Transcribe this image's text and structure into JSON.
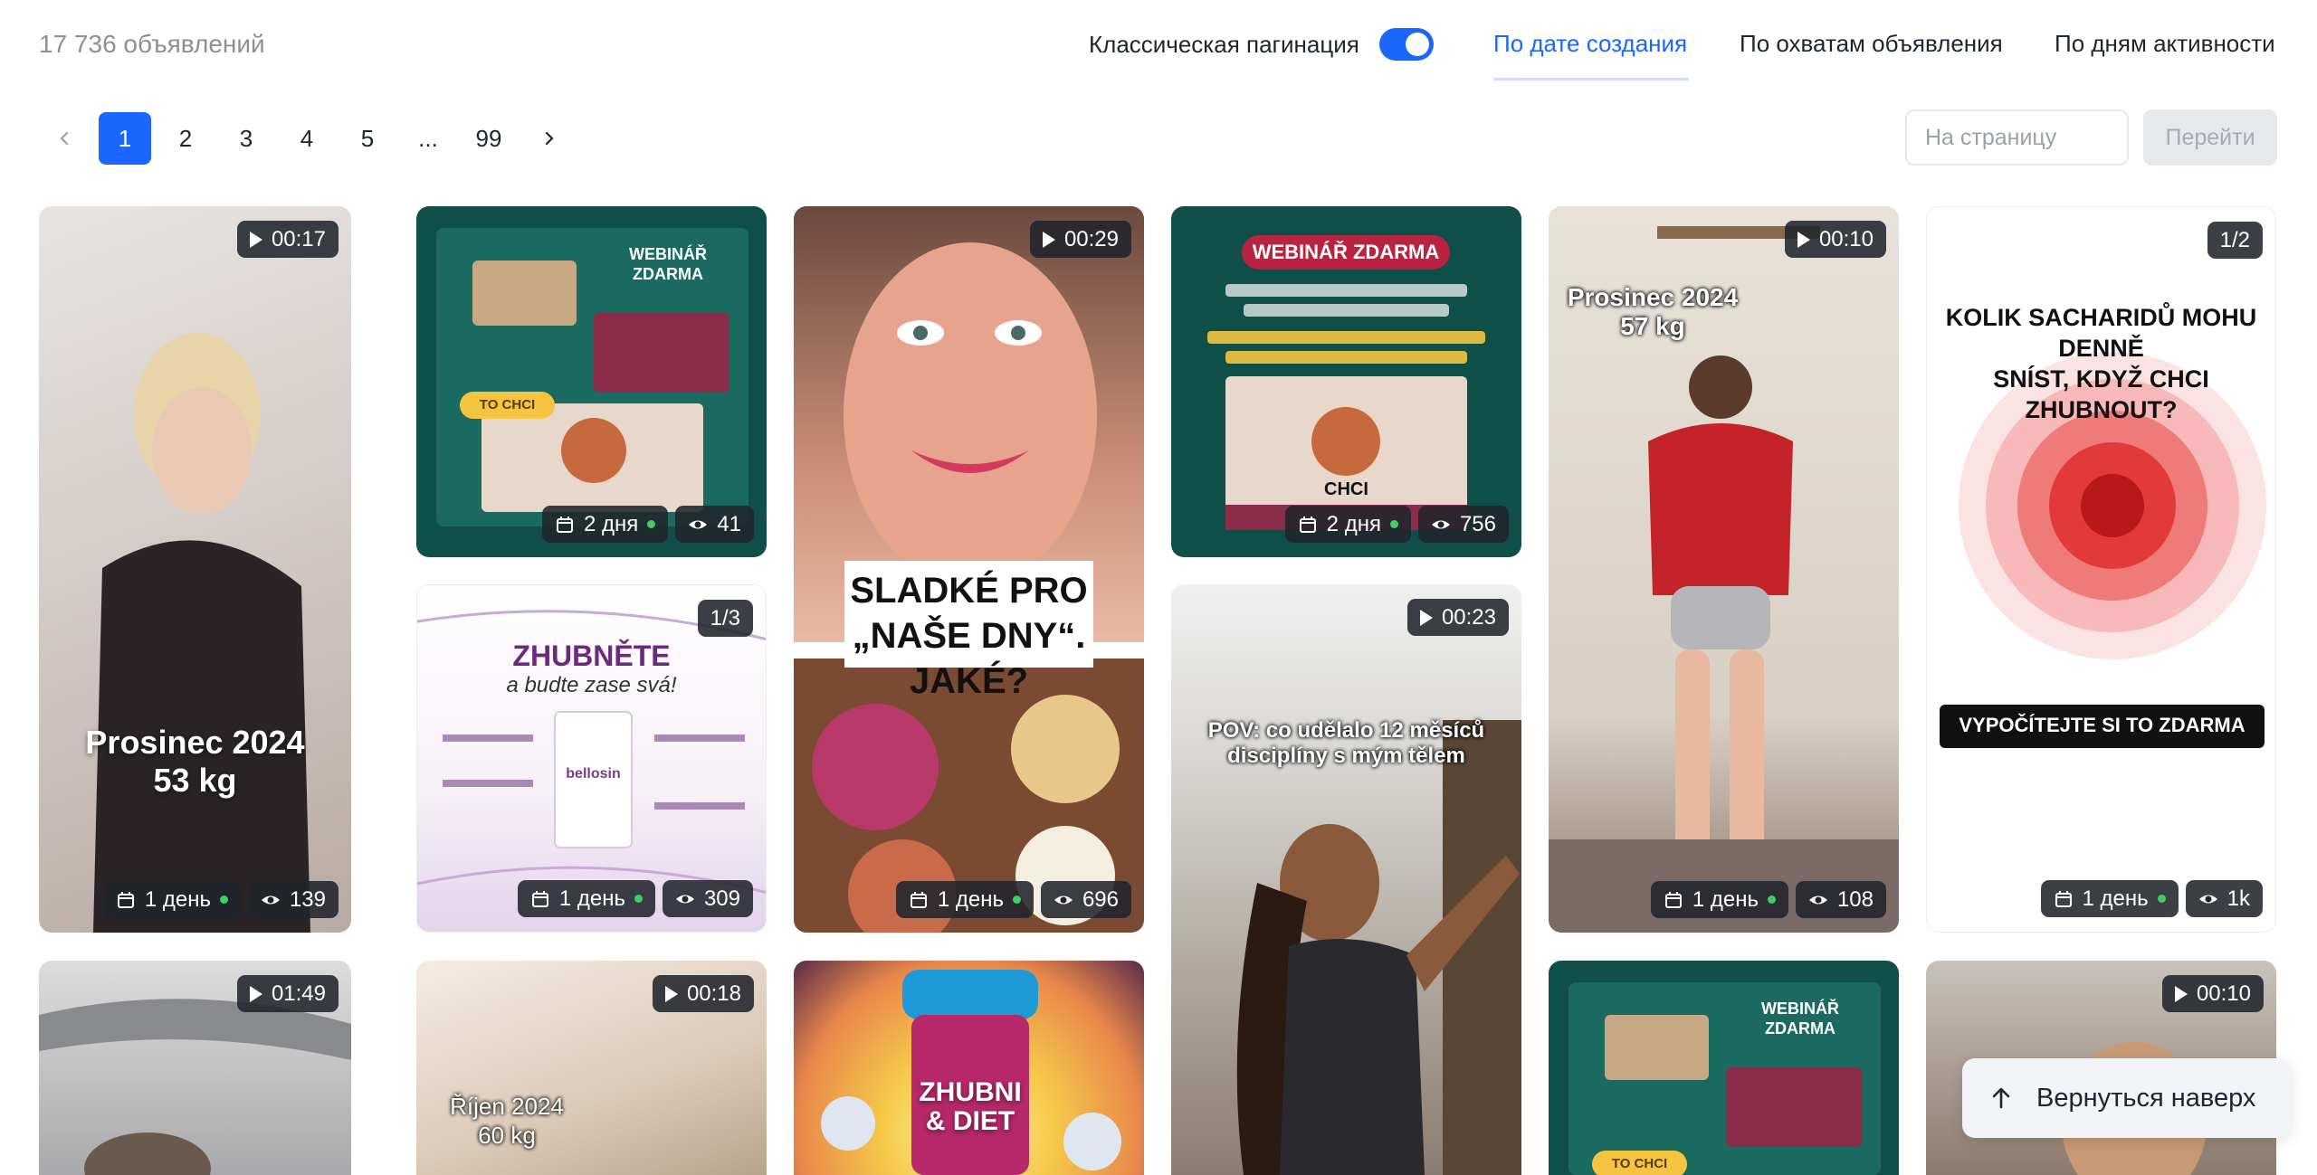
{
  "header": {
    "total_count": "17 736 объявлений",
    "pagination_toggle_label": "Классическая пагинация",
    "pagination_toggle_on": true,
    "sort_tabs": [
      {
        "label": "По дате создания",
        "active": true
      },
      {
        "label": "По охватам объявления",
        "active": false
      },
      {
        "label": "По дням активности",
        "active": false
      }
    ]
  },
  "pagination": {
    "pages": [
      "1",
      "2",
      "3",
      "4",
      "5",
      "...",
      "99"
    ],
    "current_page": "1",
    "page_input_placeholder": "На страницу",
    "go_label": "Перейти"
  },
  "accent_color": "#1a66ff",
  "cards": [
    {
      "type": "video",
      "duration": "00:17",
      "overlay_text": [
        "Prosinec 2024",
        "53 kg"
      ],
      "age": "1 день",
      "views": "139"
    },
    {
      "type": "image",
      "overlay_text": [
        "WEBINÁŘ",
        "ZDARMA",
        "TO CHCI"
      ],
      "age": "2 дня",
      "views": "41"
    },
    {
      "type": "video",
      "duration": "00:29",
      "overlay_text": [
        "SLADKÉ PRO",
        "„NAŠE DNY“. JAKÉ?"
      ],
      "age": "1 день",
      "views": "696"
    },
    {
      "type": "image",
      "overlay_text": [
        "WEBINÁŘ ZDARMA",
        "CHCI"
      ],
      "age": "2 дня",
      "views": "756"
    },
    {
      "type": "video",
      "duration": "00:10",
      "overlay_text": [
        "Prosinec 2024",
        "57 kg"
      ],
      "age": "1 день",
      "views": "108"
    },
    {
      "type": "carousel",
      "slides": "1/2",
      "overlay_text": [
        "KOLIK SACHARIDŮ MOHU DENNĚ",
        "SNÍST, KDYŽ CHCI ZHUBNOUT?",
        "VYPOČÍTEJTE SI TO ZDARMA"
      ],
      "age": "1 день",
      "views": "1k"
    },
    {
      "type": "carousel",
      "slides": "1/3",
      "overlay_text": [
        "ZHUBNĚTE",
        "a budte zase svá!",
        "bellosin"
      ],
      "age": "1 день",
      "views": "309"
    },
    {
      "type": "video",
      "duration": "00:23",
      "overlay_text": [
        "POV: co udělalo 12 měsíců",
        "disciplíny s mým tělem"
      ]
    },
    {
      "type": "video",
      "duration": "01:49"
    },
    {
      "type": "video",
      "duration": "00:18",
      "overlay_text": [
        "Říjen 2024",
        "60 kg"
      ]
    },
    {
      "type": "image",
      "overlay_text": [
        "ZHUBNI",
        "& DIET"
      ]
    },
    {
      "type": "image",
      "overlay_text": [
        "WEBINÁŘ",
        "ZDARMA",
        "TO CHCI"
      ]
    },
    {
      "type": "video",
      "duration": "00:10"
    }
  ],
  "back_to_top_label": "Вернуться наверх"
}
